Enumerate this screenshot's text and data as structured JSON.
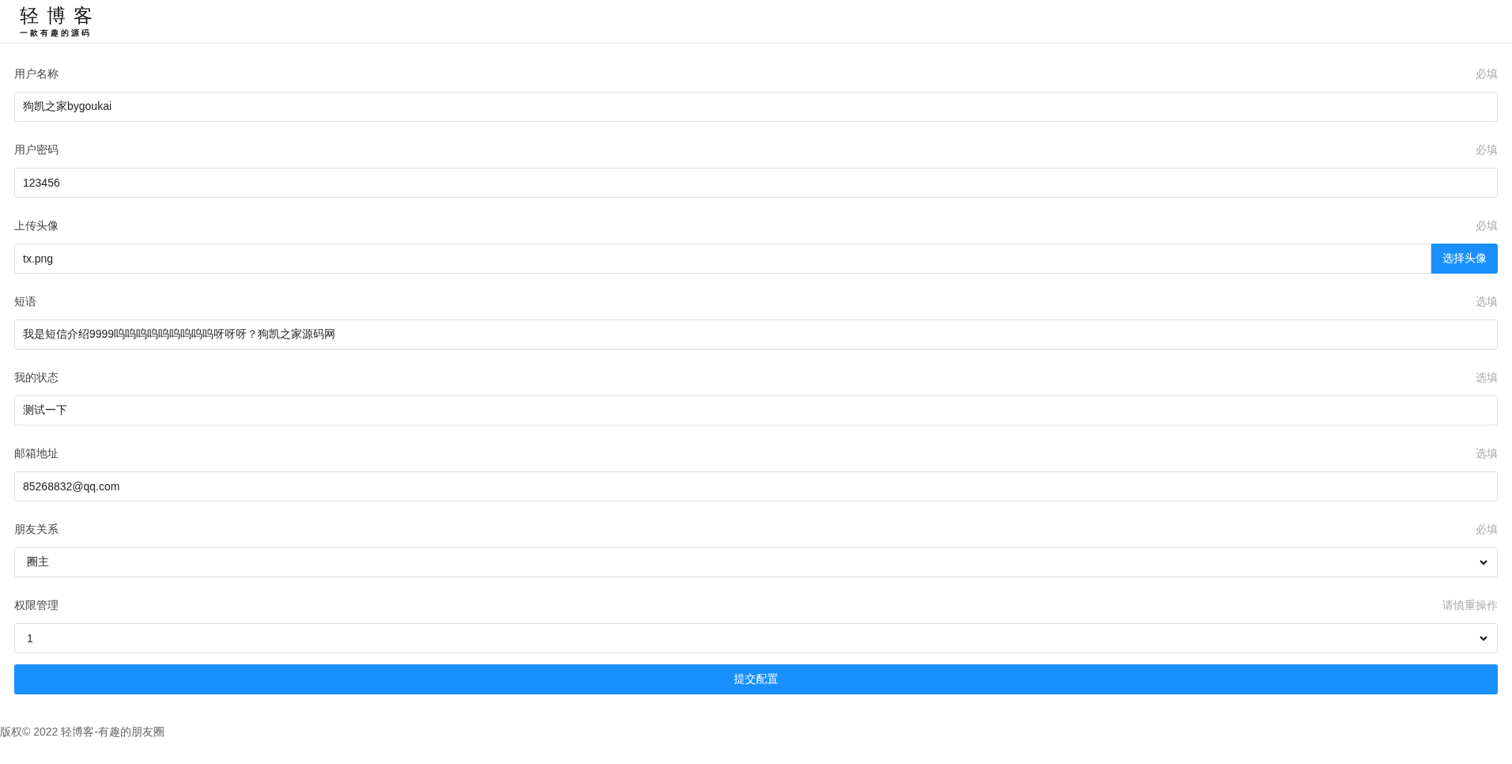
{
  "header": {
    "logo_title": "轻博客",
    "logo_subtitle": "一款有趣的源码"
  },
  "fields": [
    {
      "kind": "text",
      "label": "用户名称",
      "hint": "必填",
      "value": "狗凯之家bygoukai"
    },
    {
      "kind": "text",
      "label": "用户密码",
      "hint": "必填",
      "value": "123456"
    },
    {
      "kind": "file",
      "label": "上传头像",
      "hint": "必填",
      "value": "tx.png",
      "button": "选择头像"
    },
    {
      "kind": "text",
      "label": "短语",
      "hint": "选填",
      "value": "我是短信介绍9999呜呜呜呜呜呜呜呜呜呀呀呀？狗凯之家源码网"
    },
    {
      "kind": "text",
      "label": "我的状态",
      "hint": "选填",
      "value": "测试一下"
    },
    {
      "kind": "text",
      "label": "邮箱地址",
      "hint": "选填",
      "value": "85268832@qq.com"
    },
    {
      "kind": "select",
      "label": "朋友关系",
      "hint": "必填",
      "value": "圈主"
    },
    {
      "kind": "select",
      "label": "权限管理",
      "hint": "请慎重操作",
      "value": "1"
    }
  ],
  "submit": "提交配置",
  "footer": "版权© 2022 轻博客-有趣的朋友圈"
}
